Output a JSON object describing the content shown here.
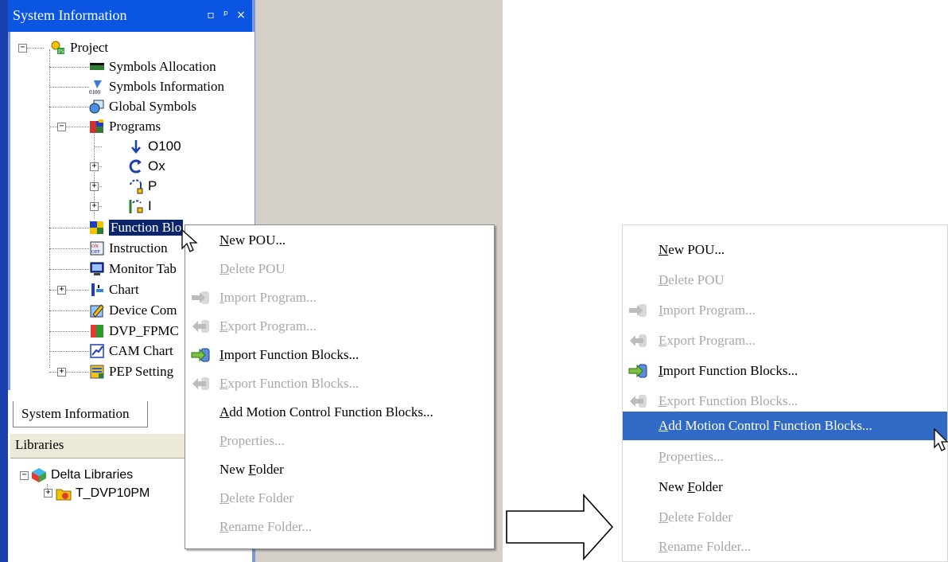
{
  "system_panel": {
    "title": "System Information",
    "tab_label": "System Information"
  },
  "tree": {
    "items": [
      {
        "label": "Project",
        "icon": "project-icon"
      },
      {
        "label": "Symbols Allocation",
        "icon": "symbols-allocation-icon"
      },
      {
        "label": "Symbols Information",
        "icon": "symbols-information-icon"
      },
      {
        "label": "Global Symbols",
        "icon": "global-symbols-icon"
      },
      {
        "label": "Programs",
        "icon": "programs-icon"
      },
      {
        "label": "O100",
        "icon": "arrow-down-icon"
      },
      {
        "label": "Ox",
        "icon": "cycle-icon"
      },
      {
        "label": "P",
        "icon": "subroutine-icon"
      },
      {
        "label": "I",
        "icon": "interrupt-icon"
      },
      {
        "label": "Function Blo",
        "icon": "function-blocks-icon"
      },
      {
        "label": "Instruction",
        "icon": "instruction-icon"
      },
      {
        "label": "Monitor Tab",
        "icon": "monitor-table-icon"
      },
      {
        "label": "Chart",
        "icon": "chart-icon"
      },
      {
        "label": "Device Com",
        "icon": "device-comment-icon"
      },
      {
        "label": "DVP_FPMC",
        "icon": "dvp-fpmc-icon"
      },
      {
        "label": "CAM Chart",
        "icon": "cam-chart-icon"
      },
      {
        "label": "PEP Setting",
        "icon": "pep-setting-icon"
      }
    ]
  },
  "libraries": {
    "header": "Libraries",
    "items": [
      {
        "label": "Delta Libraries",
        "icon": "delta-libraries-icon"
      },
      {
        "label": "T_DVP10PM",
        "icon": "folder-library-icon"
      }
    ]
  },
  "context_menu": {
    "items": [
      {
        "pre": "",
        "key": "N",
        "post": "ew POU...",
        "enabled": true,
        "icon": ""
      },
      {
        "pre": "",
        "key": "D",
        "post": "elete POU",
        "enabled": false,
        "icon": ""
      },
      {
        "pre": "",
        "key": "I",
        "post": "mport Program...",
        "enabled": false,
        "icon": "import-icon"
      },
      {
        "pre": "",
        "key": "E",
        "post": "xport Program...",
        "enabled": false,
        "icon": "export-icon"
      },
      {
        "pre": "",
        "key": "I",
        "post": "mport Function Blocks...",
        "enabled": true,
        "icon": "import-icon"
      },
      {
        "pre": "",
        "key": "E",
        "post": "xport Function Blocks...",
        "enabled": false,
        "icon": "export-icon"
      },
      {
        "pre": "",
        "key": "A",
        "post": "dd Motion Control Function Blocks...",
        "enabled": true,
        "icon": ""
      },
      {
        "pre": "",
        "key": "P",
        "post": "roperties...",
        "enabled": false,
        "icon": ""
      },
      {
        "pre": "New ",
        "key": "F",
        "post": "older",
        "enabled": true,
        "icon": ""
      },
      {
        "pre": "",
        "key": "D",
        "post": "elete Folder",
        "enabled": false,
        "icon": ""
      },
      {
        "pre": "",
        "key": "R",
        "post": "ename Folder...",
        "enabled": false,
        "icon": ""
      }
    ],
    "highlighted_right": "Add Motion Control Function Blocks..."
  },
  "colors": {
    "titlebar": "#0b55e3",
    "highlight": "#316ac5",
    "disabled_text": "#a8a8a8",
    "selection": "#0a246a"
  }
}
